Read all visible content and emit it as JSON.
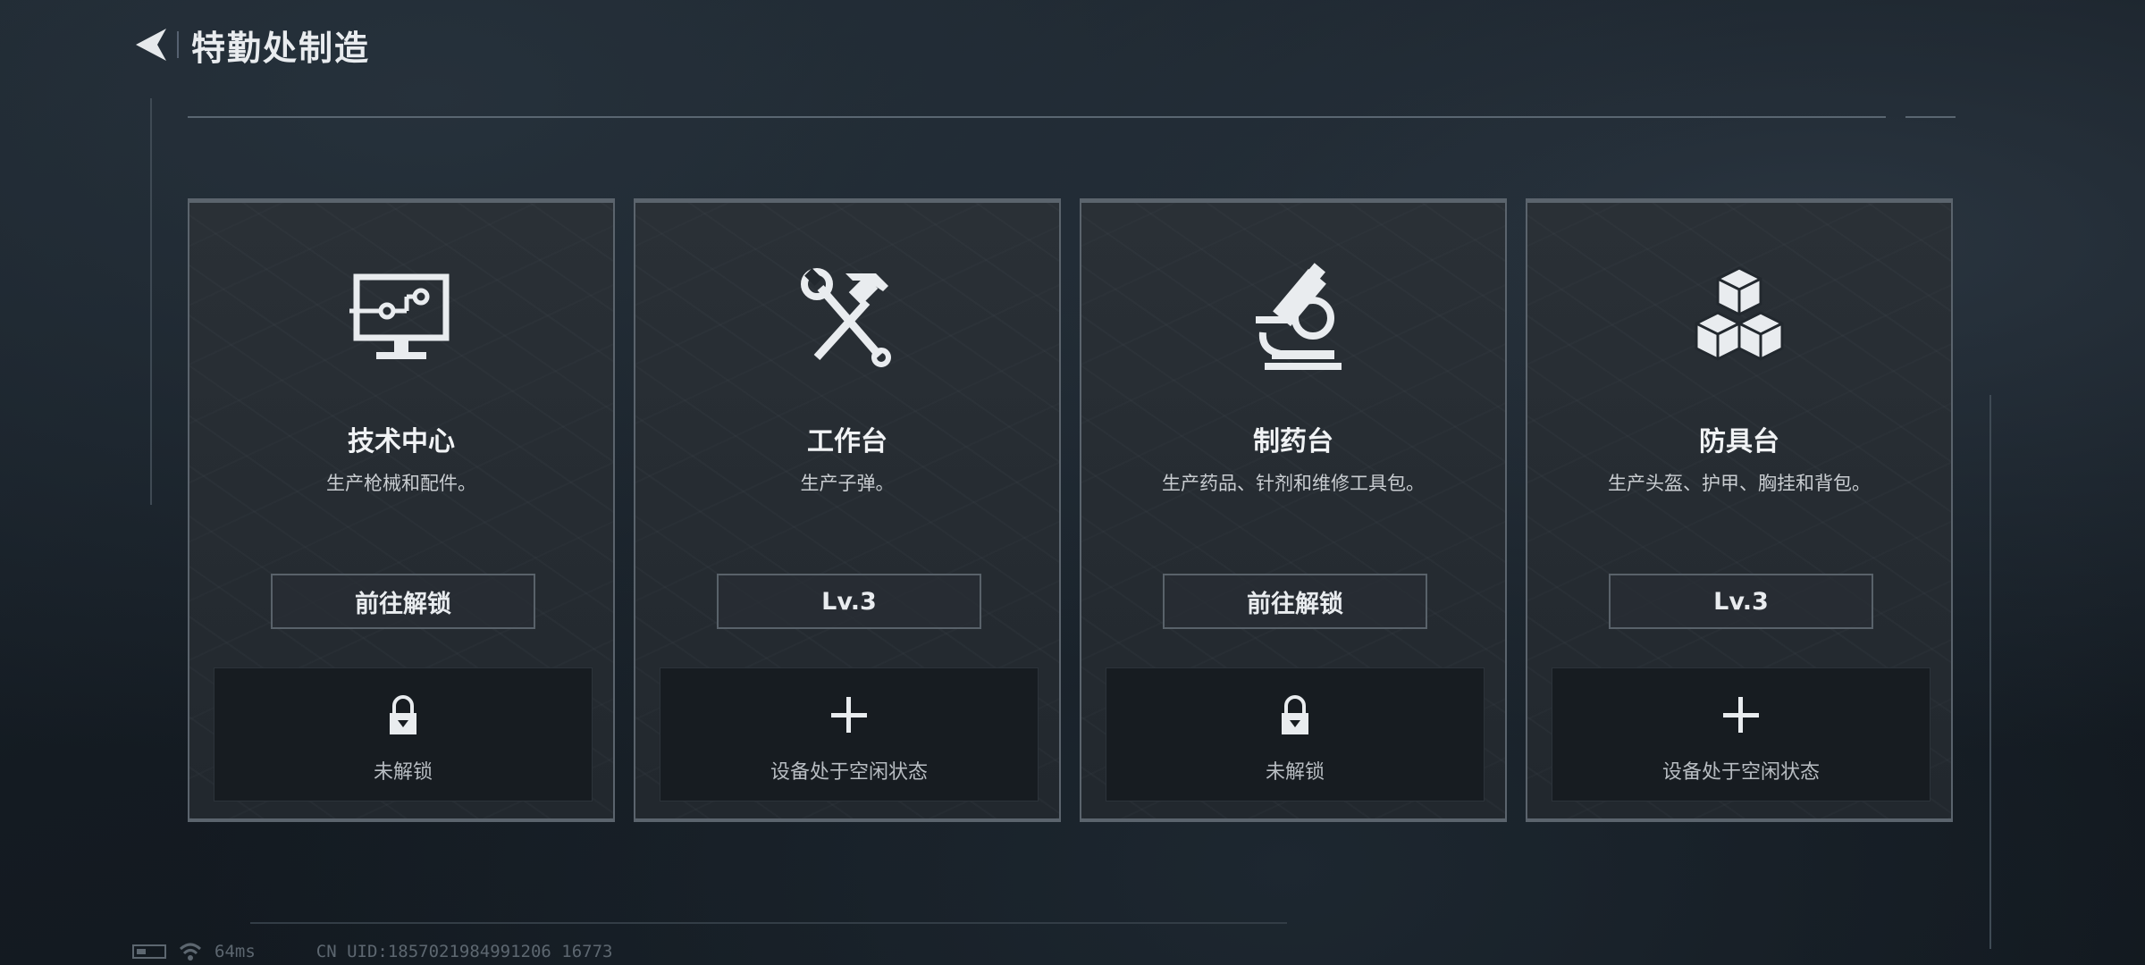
{
  "header": {
    "title": "特勤处制造"
  },
  "cards": [
    {
      "title": "技术中心",
      "desc": "生产枪械和配件。",
      "button": "前往解锁",
      "slot_label": "未解锁",
      "icon": "monitor-icon",
      "slot_icon": "lock-icon"
    },
    {
      "title": "工作台",
      "desc": "生产子弹。",
      "button": "Lv.3",
      "slot_label": "设备处于空闲状态",
      "icon": "hammer-wrench-icon",
      "slot_icon": "plus-icon"
    },
    {
      "title": "制药台",
      "desc": "生产药品、针剂和维修工具包。",
      "button": "前往解锁",
      "slot_label": "未解锁",
      "icon": "microscope-icon",
      "slot_icon": "lock-icon"
    },
    {
      "title": "防具台",
      "desc": "生产头盔、护甲、胸挂和背包。",
      "button": "Lv.3",
      "slot_label": "设备处于空闲状态",
      "icon": "cubes-icon",
      "slot_icon": "plus-icon"
    }
  ],
  "status": {
    "ping": "64ms",
    "uid": "CN UID:1857021984991206 16773"
  }
}
